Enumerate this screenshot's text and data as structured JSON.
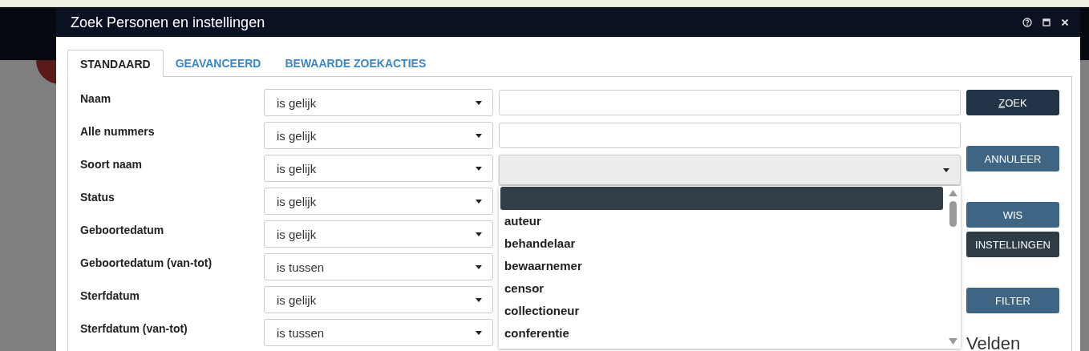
{
  "window": {
    "title": "Zoek Personen en instellingen"
  },
  "tabs": [
    {
      "label": "STANDAARD",
      "selected": true
    },
    {
      "label": "GEAVANCEERD",
      "selected": false
    },
    {
      "label": "BEWAARDE ZOEKACTIES",
      "selected": false
    }
  ],
  "criteria": [
    {
      "label": "Naam",
      "operator": "is gelijk",
      "kind": "text"
    },
    {
      "label": "Alle nummers",
      "operator": "is gelijk",
      "kind": "text"
    },
    {
      "label": "Soort naam",
      "operator": "is gelijk",
      "kind": "dropdown",
      "expanded": true
    },
    {
      "label": "Status",
      "operator": "is gelijk",
      "kind": "covered"
    },
    {
      "label": "Geboortedatum",
      "operator": "is gelijk",
      "kind": "covered"
    },
    {
      "label": "Geboortedatum (van-tot)",
      "operator": "is tussen",
      "kind": "covered"
    },
    {
      "label": "Sterfdatum",
      "operator": "is gelijk",
      "kind": "covered"
    },
    {
      "label": "Sterfdatum (van-tot)",
      "operator": "is tussen",
      "kind": "covered"
    }
  ],
  "dropdown_options": [
    {
      "selected": true
    },
    {
      "label": "auteur",
      "selected": false
    },
    {
      "label": "behandelaar",
      "selected": false
    },
    {
      "label": "bewaarnemer",
      "selected": false
    },
    {
      "label": "censor",
      "selected": false
    },
    {
      "label": "collectioneur",
      "selected": false
    },
    {
      "label": "conferentie",
      "selected": false
    }
  ],
  "buttons": [
    {
      "label": "ZOEK",
      "kind": "primary"
    },
    {
      "label": "ANNULEER",
      "kind": "secondary"
    },
    {
      "label": "WIS",
      "kind": "secondary"
    },
    {
      "label": "INSTELLINGEN",
      "kind": "dark"
    },
    {
      "label": "FILTER",
      "kind": "secondary"
    }
  ],
  "section_heading": "Velden"
}
